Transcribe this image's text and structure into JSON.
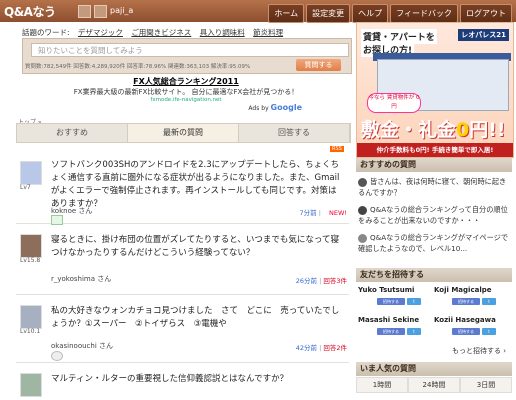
{
  "header": {
    "logo": "Q&Aなう",
    "username": "paji_a",
    "nav": [
      "ホーム",
      "設定変更",
      "ヘルプ",
      "フィードバック",
      "ログアウト"
    ]
  },
  "hotwords": {
    "label": "話題のワード:",
    "items": [
      "デザマジック",
      "ご用聞きビジネス",
      "具入り調味料",
      "節炎料理"
    ]
  },
  "question_box": {
    "placeholder": "知りたいことを質問してみよう",
    "stats": "質問数:782,549件 回答数:4,289,920件 回答率:78.96% 関連数:363,103 解決率:95.09%",
    "submit": "質問する"
  },
  "ad": {
    "title": "FX人気総合ランキング2011",
    "desc": "FX業界最大級の最新FX比較サイト。 自分に最適なFX会社が見つかる！",
    "url": "fxmode.ife-navigation.net",
    "by": "Ads by",
    "by_brand": "Google"
  },
  "breadcrumb": "トップ »",
  "tabs": [
    "おすすめ",
    "最新の質問",
    "回答する"
  ],
  "rss": "RSS",
  "questions": [
    {
      "level": "Lv7",
      "text": "ソフトバンク003SHのアンドロイドを2.3にアップデートしたら、ちょくちょく通信する直前に圏外になる症状が出るようになりました。また、Gmailがよくエラーで強制停止されます。再インストールしても同じです。対策はありますか？",
      "user": "koknoe さん",
      "time": "7分前",
      "answers": "",
      "new": "NEW!"
    },
    {
      "level": "Lv15.8",
      "text": "寝るときに、掛け布団の位置がズレてたりすると、いつまでも気になって寝つけなかったりするんだけどこういう経験ってない？",
      "user": "r_yokoshima さん",
      "time": "26分前",
      "answers": "回答3件",
      "new": ""
    },
    {
      "level": "Lv10.1",
      "text": "私の大好きなウォンカチョコ見つけました　さて　どこに　売っていたでしょうか？①スーパー　②トイザらス　③電機や",
      "user": "okasinoouchi さん",
      "time": "42分前",
      "answers": "回答2件",
      "new": ""
    },
    {
      "level": "",
      "text": "マルティン・ルターの重要視した信仰義認説とはなんですか？",
      "user": "",
      "time": "",
      "answers": "",
      "new": ""
    }
  ],
  "side_ad": {
    "line1": "賃貸・アパートを",
    "line2": "お探しの方!",
    "brand": "レオパレス21",
    "badge": "今なら 賃貸物件が 0円",
    "big_a": "敷金・礼金",
    "big_b": "0",
    "big_c": "円!!",
    "bottom": "仲介手数料も0円! 手続き簡単で即入居!"
  },
  "recommended": {
    "title": "おすすめの質問",
    "items": [
      "皆さんは、夜は何時に寝て、朝何時に起きるんですか？",
      "Q&Aなうの総合ランキングって自分の順位をみることが出来ないのですか・・・",
      "Q&Aなうの総合ランキングがマイページで確認したようなので、レベル10..."
    ]
  },
  "friends": {
    "title": "友だちを招待する",
    "names": [
      "Yuko Tsutsumi",
      "Koji Magicalpe",
      "Masashi Sekine",
      "Kozii Hasegawa"
    ],
    "invite": "招待する",
    "more": "もっと招待する ›"
  },
  "popular": {
    "title": "いま人気の質問",
    "tabs": [
      "1時間",
      "24時間",
      "3日間"
    ]
  }
}
